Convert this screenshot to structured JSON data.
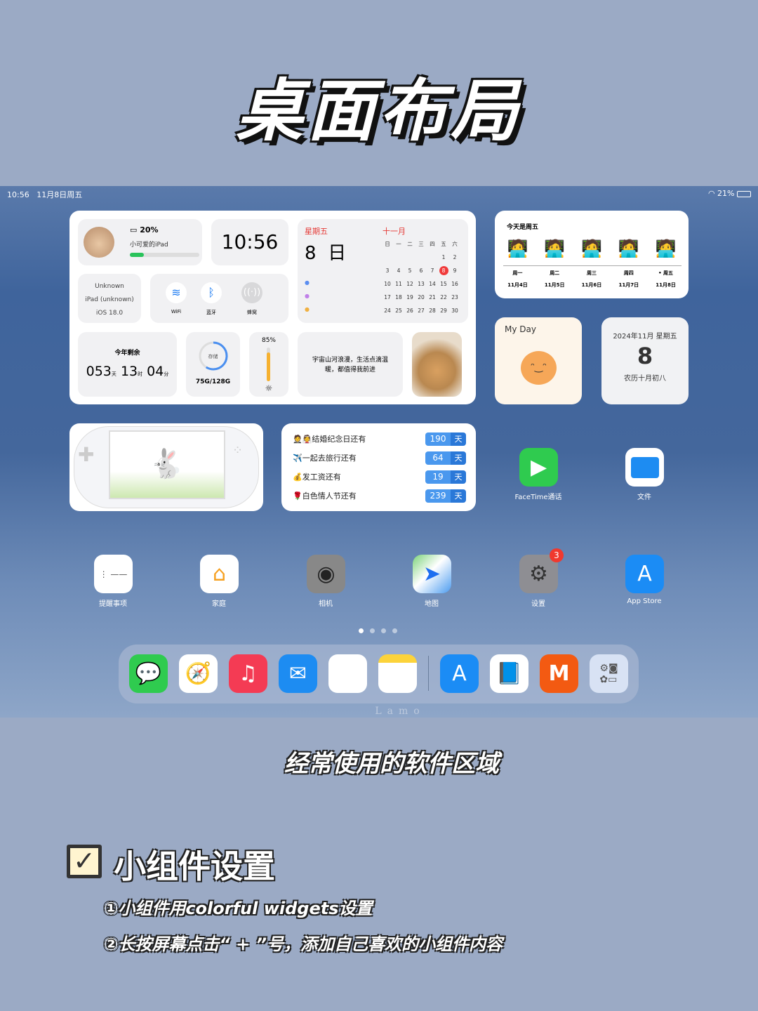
{
  "page_title": "桌面布局",
  "status_bar": {
    "time": "10:56",
    "date": "11月8日周五",
    "battery": "21%"
  },
  "battery_widget": {
    "percent": "20%",
    "device_name": "小可爱的iPad",
    "level": 0.2
  },
  "clock_widget": {
    "time": "10:56"
  },
  "calendar_widget": {
    "weekday": "星期五",
    "day": "8",
    "day_unit": "日",
    "month": "十一月",
    "headers": [
      "日",
      "一",
      "二",
      "三",
      "四",
      "五",
      "六"
    ],
    "weeks": [
      [
        "",
        "",
        "",
        "",
        "",
        "1",
        "2"
      ],
      [
        "3",
        "4",
        "5",
        "6",
        "7",
        "8",
        "9"
      ],
      [
        "10",
        "11",
        "12",
        "13",
        "14",
        "15",
        "16"
      ],
      [
        "17",
        "18",
        "19",
        "20",
        "21",
        "22",
        "23"
      ],
      [
        "24",
        "25",
        "26",
        "27",
        "28",
        "29",
        "30"
      ]
    ],
    "today": "8"
  },
  "device_widget": {
    "brand": "Unknown",
    "model": "iPad (unknown)",
    "os": "iOS 18.0"
  },
  "connectivity": {
    "wifi": "WiFi",
    "bluetooth": "蓝牙",
    "cellular": "蜂窝"
  },
  "year_remaining": {
    "label": "今年剩余",
    "days": "053",
    "days_unit": "天",
    "hours": "13",
    "hours_unit": "时",
    "minutes": "04",
    "minutes_unit": "分"
  },
  "storage": {
    "label": "存储",
    "value": "75G/128G",
    "fraction": 0.59
  },
  "brightness": {
    "value": "85%",
    "level": 0.85
  },
  "quote": {
    "text": "宇宙山河浪漫，生活点滴温暖，都值得我前进"
  },
  "week_widget": {
    "title": "今天是周五",
    "days": [
      {
        "name": "周一",
        "date": "11月4日"
      },
      {
        "name": "周二",
        "date": "11月5日"
      },
      {
        "name": "周三",
        "date": "11月6日"
      },
      {
        "name": "周四",
        "date": "11月7日"
      },
      {
        "name": "• 周五",
        "date": "11月8日"
      }
    ]
  },
  "myday": {
    "title": "My Day"
  },
  "lunar": {
    "header": "2024年11月 星期五",
    "day": "8",
    "lunar": "农历十月初八"
  },
  "countdowns": [
    {
      "emoji": "🤵👰",
      "label": "结婚纪念日还有",
      "days": "190",
      "unit": "天"
    },
    {
      "emoji": "✈️",
      "label": "一起去旅行还有",
      "days": "64",
      "unit": "天"
    },
    {
      "emoji": "💰",
      "label": "发工资还有",
      "days": "19",
      "unit": "天"
    },
    {
      "emoji": "🌹",
      "label": "白色情人节还有",
      "days": "239",
      "unit": "天"
    }
  ],
  "apps": {
    "facetime": "FaceTime通话",
    "files": "文件",
    "reminders": "提醒事项",
    "home": "家庭",
    "camera": "相机",
    "maps": "地图",
    "settings": "设置",
    "settings_badge": "3",
    "appstore": "App Store"
  },
  "watermark": "Lamo",
  "caption": "经常使用的软件区域",
  "section": {
    "heading": "小组件设置",
    "line1": "①小组件用colorful widgets设置",
    "line2": "②长按屏幕点击“ + ”号，添加自己喜欢的小组件内容"
  }
}
